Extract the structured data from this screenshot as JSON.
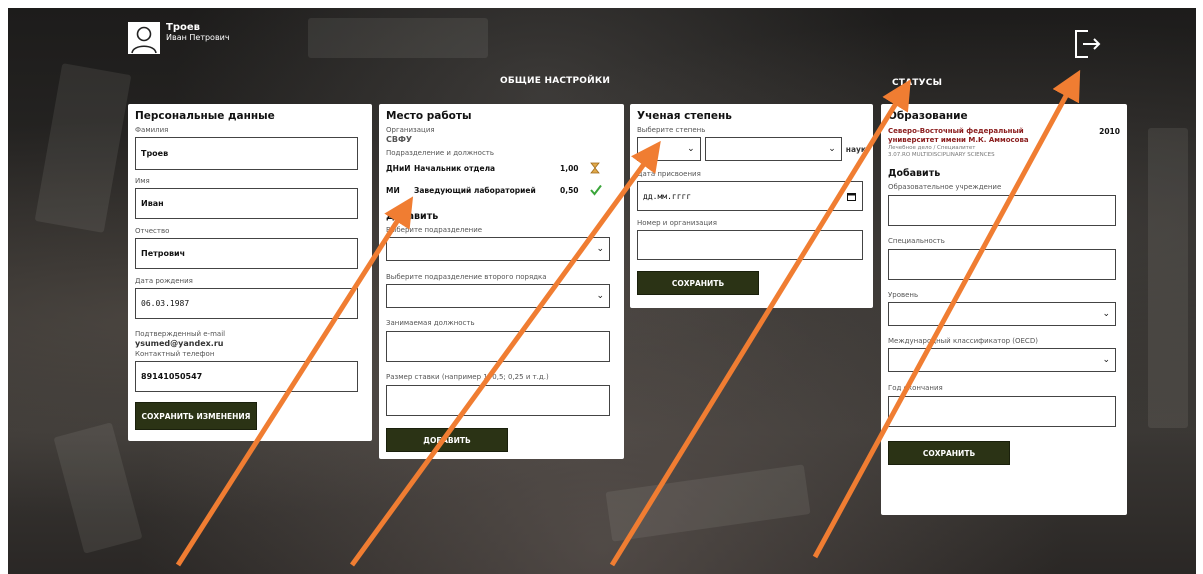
{
  "user": {
    "name": "Троев",
    "full": "Иван Петрович"
  },
  "sections": {
    "general": "ОБЩИЕ НАСТРОЙКИ",
    "statuses": "СТАТУСЫ"
  },
  "personal": {
    "title": "Персональные данные",
    "surname_label": "Фамилия",
    "surname": "Троев",
    "name_label": "Имя",
    "name": "Иван",
    "patronymic_label": "Отчество",
    "patronymic": "Петрович",
    "birth_label": "Дата рождения",
    "birth": "06.03.1987",
    "email_label": "Подтвержденный e-mail",
    "email": "ysumed@yandex.ru",
    "phone_label": "Контактный телефон",
    "phone": "89141050547",
    "save": "СОХРАНИТЬ ИЗМЕНЕНИЯ"
  },
  "work": {
    "title": "Место работы",
    "org_label": "Организация",
    "org": "СВФУ",
    "dept_label": "Подразделение и должность",
    "rows": [
      {
        "code": "ДНиИ",
        "position": "Начальник отдела",
        "rate": "1,00",
        "status": "hourglass-icon"
      },
      {
        "code": "МИ",
        "position": "Заведующий лабораторией",
        "rate": "0,50",
        "status": "check-icon"
      }
    ],
    "add_title": "Добавить",
    "dept_select_label": "Выберите подразделение",
    "dept2_select_label": "Выберите подразделение второго порядка",
    "position_label": "Занимаемая должность",
    "rate_label": "Размер ставки (например 1; 0,5; 0,25 и т.д.)",
    "add_btn": "ДОБАВИТЬ"
  },
  "degree": {
    "title": "Ученая степень",
    "select_label": "Выберите степень",
    "suffix": "наук",
    "date_label": "Дата присвоения",
    "date_placeholder": "дд.мм.гггг",
    "number_label": "Номер и организация",
    "save": "СОХРАНИТЬ"
  },
  "education": {
    "title": "Образование",
    "entry_name": "Северо-Восточный федеральный университет имени М.К. Аммосова",
    "entry_year": "2010",
    "entry_sub1": "Лечебное дело / Специалитет",
    "entry_sub2": "3.07.RO MULTIDISCIPLINARY SCIENCES",
    "add_title": "Добавить",
    "inst_label": "Образовательное учреждение",
    "spec_label": "Специальность",
    "level_label": "Уровень",
    "oecd_label": "Международный классификатор (OECD)",
    "year_label": "Год окончания",
    "save": "СОХРАНИТЬ"
  }
}
